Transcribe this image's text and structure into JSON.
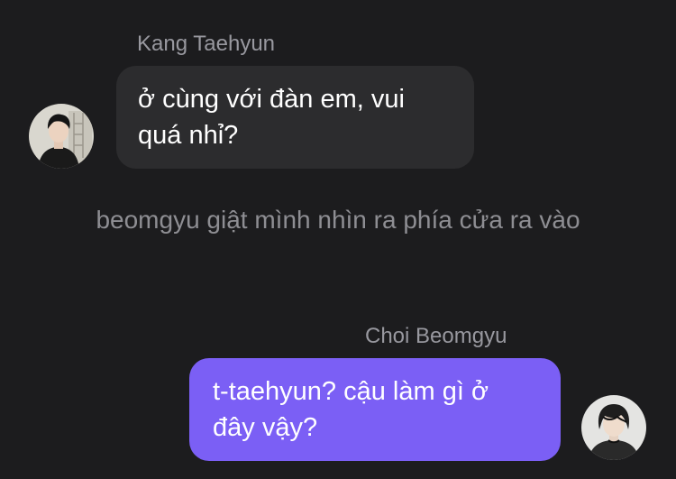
{
  "colors": {
    "background": "#1c1c1e",
    "incoming_bubble": "#2c2c2e",
    "outgoing_bubble": "#7b5ff5",
    "name_text": "#98989f",
    "narration_text": "#8e8e93"
  },
  "messages": [
    {
      "sender": "Kang Taehyun",
      "text": "ở cùng với đàn em, vui quá nhỉ?",
      "direction": "incoming",
      "avatar_icon": "user-avatar-photo"
    },
    {
      "narration": "beomgyu giật mình nhìn ra phía cửa ra vào"
    },
    {
      "sender": "Choi Beomgyu",
      "text": "t-taehyun? cậu làm gì ở đây vậy?",
      "direction": "outgoing",
      "avatar_icon": "user-avatar-photo"
    }
  ]
}
